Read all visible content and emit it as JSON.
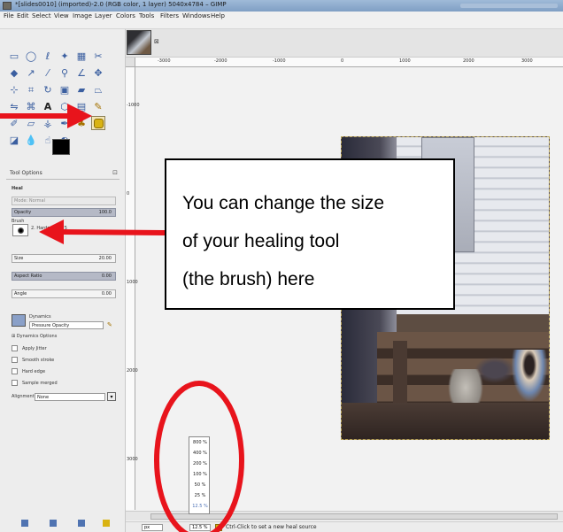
{
  "window": {
    "title": "*[slides0010] (imported)-2.0 (RGB color, 1 layer) 5040x4784 – GIMP"
  },
  "menubar": {
    "items": [
      "File",
      "Edit",
      "Select",
      "View",
      "Image",
      "Layer",
      "Colors",
      "Tools",
      "Filters",
      "Windows",
      "Help"
    ]
  },
  "toolbox": {
    "icons": [
      "rect-select-icon",
      "ellipse-select-icon",
      "free-select-icon",
      "fuzzy-select-icon",
      "color-select-icon",
      "scissors-icon",
      "foreground-select-icon",
      "paths-icon",
      "color-picker-icon",
      "zoom-icon",
      "measure-icon",
      "move-icon",
      "align-icon",
      "crop-icon",
      "rotate-icon",
      "scale-icon",
      "shear-icon",
      "perspective-icon",
      "flip-icon",
      "cage-icon",
      "text-icon",
      "bucket-fill-icon",
      "blend-icon",
      "pencil-icon",
      "paintbrush-icon",
      "eraser-icon",
      "airbrush-icon",
      "ink-icon",
      "clone-icon",
      "heal-icon",
      "perspective-clone-icon",
      "blur-icon",
      "smudge-icon",
      "dodge-burn-icon"
    ]
  },
  "tool_options": {
    "tab_label": "Tool Options",
    "tool_name": "Heal",
    "mode_label": "Mode:",
    "mode_value": "Normal",
    "opacity_label": "Opacity",
    "opacity_value": "100.0",
    "brush_label": "Brush",
    "brush_value": "2. Hardness 075",
    "size_label": "Size",
    "size_value": "20.00",
    "aspect_label": "Aspect Ratio",
    "aspect_value": "0.00",
    "angle_label": "Angle",
    "angle_value": "0.00",
    "dynamics_label": "Dynamics",
    "dynamics_value": "Pressure Opacity",
    "dynamics_options": "Dynamics Options",
    "apply_jitter": "Apply Jitter",
    "smooth_stroke": "Smooth stroke",
    "hard_edge": "Hard edge",
    "sample_merged": "Sample merged",
    "alignment_label": "Alignment:",
    "alignment_value": "None"
  },
  "ruler": {
    "h_ticks": [
      "-3000",
      "-2000",
      "-1000",
      "0",
      "1000",
      "2000",
      "3000"
    ],
    "v_ticks": [
      "-1000",
      "0",
      "1000",
      "2000",
      "3000"
    ]
  },
  "zoom_menu": {
    "options": [
      "800 %",
      "400 %",
      "200 %",
      "100 %",
      "50 %",
      "25 %",
      "12.5 %"
    ],
    "selected": "12.5 %"
  },
  "statusbar": {
    "unit": "px",
    "zoom": "12.5 %",
    "message": "Ctrl-Click to set a new heal source"
  },
  "annotation": {
    "callout_lines": [
      "You can change the size",
      "of your healing tool",
      "(the brush) here"
    ],
    "arrow_color": "#e8141c",
    "circle_color": "#e8141c"
  }
}
